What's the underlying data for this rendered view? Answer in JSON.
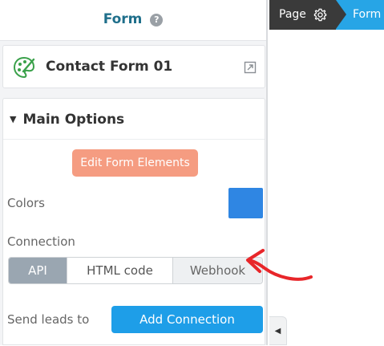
{
  "panel": {
    "title": "Form",
    "help_glyph": "?",
    "form_card": {
      "name": "Contact Form 01",
      "icon": "palette-icon",
      "open_icon": "external-link-icon"
    },
    "main_options": {
      "title": "Main Options",
      "edit_button": "Edit Form Elements",
      "colors_label": "Colors",
      "color_value": "#2f86e3",
      "connection_label": "Connection",
      "connection_tabs": [
        "API",
        "HTML code",
        "Webhook"
      ],
      "selected_tab": "API",
      "send_leads_label": "Send leads to",
      "add_connection_button": "Add Connection"
    }
  },
  "breadcrumb": {
    "page_label": "Page",
    "form_label": "Form"
  },
  "colors": {
    "accent_blue": "#27a5e6",
    "button_orange": "#f59c81",
    "annotation_red": "#e8262a"
  }
}
